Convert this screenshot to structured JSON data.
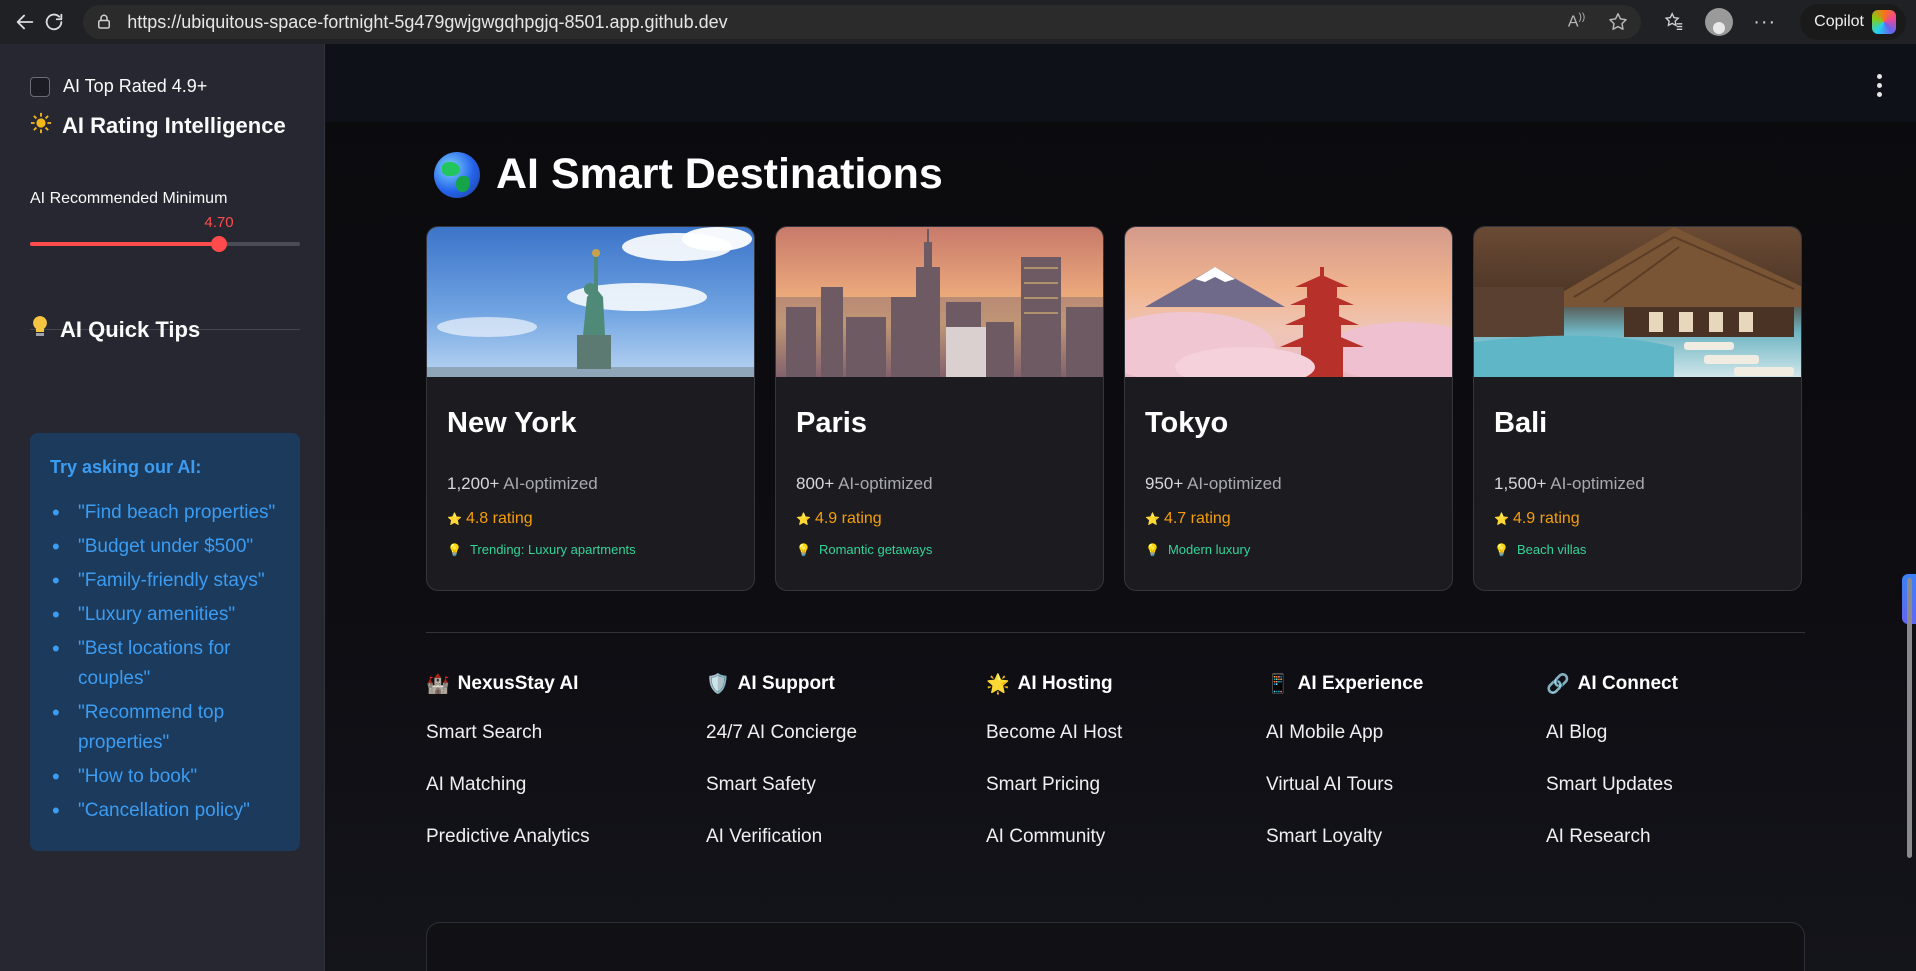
{
  "browser": {
    "url": "https://ubiquitous-space-fortnight-5g479gwjgwgqhpgjq-8501.app.github.dev",
    "copilot_label": "Copilot"
  },
  "sidebar": {
    "checkbox_label": "AI Top Rated 4.9+",
    "rating_title": "AI Rating Intelligence",
    "slider_label": "AI Recommended Minimum",
    "slider_value": "4.70",
    "slider_fraction": 0.7,
    "tips_title": "AI Quick Tips",
    "tips_heading": "Try asking our AI:",
    "tips": [
      "\"Find beach properties\"",
      "\"Budget under $500\"",
      "\"Family-friendly stays\"",
      "\"Luxury amenities\"",
      "\"Best locations for couples\"",
      "\"Recommend top properties\"",
      "\"How to book\"",
      "\"Cancellation policy\""
    ]
  },
  "main": {
    "title": "AI Smart Destinations",
    "destinations": [
      {
        "name": "New York",
        "count": "1,200+",
        "suffix": "AI-optimized",
        "rating": "4.8 rating",
        "trend": "Trending: Luxury apartments"
      },
      {
        "name": "Paris",
        "count": "800+",
        "suffix": "AI-optimized",
        "rating": "4.9 rating",
        "trend": "Romantic getaways"
      },
      {
        "name": "Tokyo",
        "count": "950+",
        "suffix": "AI-optimized",
        "rating": "4.7 rating",
        "trend": "Modern luxury"
      },
      {
        "name": "Bali",
        "count": "1,500+",
        "suffix": "AI-optimized",
        "rating": "4.9 rating",
        "trend": "Beach villas"
      }
    ]
  },
  "footer": {
    "columns": [
      {
        "title": "NexusStay AI",
        "links": [
          "Smart Search",
          "AI Matching",
          "Predictive Analytics"
        ]
      },
      {
        "title": "AI Support",
        "links": [
          "24/7 AI Concierge",
          "Smart Safety",
          "AI Verification"
        ]
      },
      {
        "title": "AI Hosting",
        "links": [
          "Become AI Host",
          "Smart Pricing",
          "AI Community"
        ]
      },
      {
        "title": "AI Experience",
        "links": [
          "AI Mobile App",
          "Virtual AI Tours",
          "Smart Loyalty"
        ]
      },
      {
        "title": "AI Connect",
        "links": [
          "AI Blog",
          "Smart Updates",
          "AI Research"
        ]
      }
    ]
  },
  "colors": {
    "accent_red": "#ff4b4b",
    "tip_blue": "#3b9cf2",
    "rating_orange": "#f59e0b",
    "trend_green": "#34d399"
  }
}
